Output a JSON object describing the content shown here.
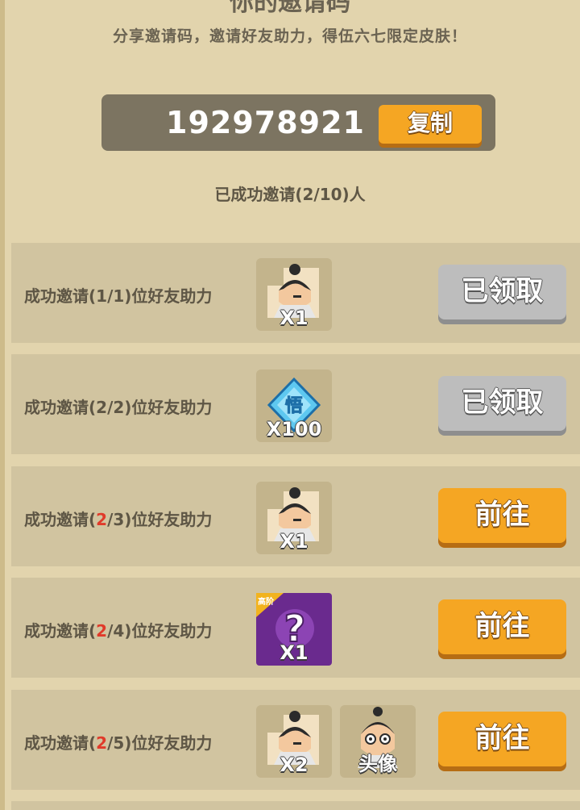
{
  "header": {
    "title": "你的邀请码",
    "subtitle": "分享邀请码，邀请好友助力，得伍六七限定皮肤！"
  },
  "invite": {
    "code": "192978921",
    "copy_label": "复制",
    "progress_text": "已成功邀请(2/10)人"
  },
  "colors": {
    "background": "#e2d4ad",
    "row": "#d1c4a0",
    "accent": "#f5a623",
    "highlight": "#e03a2a",
    "claimed": "#bdbdbd"
  },
  "rewards": [
    {
      "label_prefix": "成功邀请(",
      "done": "1",
      "sep_total": "/1)位好友助力",
      "done_highlighted": false,
      "items": [
        {
          "icon": "character-fragment-icon",
          "qty": "X1"
        }
      ],
      "button": "已领取",
      "state": "claimed"
    },
    {
      "label_prefix": "成功邀请(",
      "done": "2",
      "sep_total": "/2)位好友助力",
      "done_highlighted": false,
      "items": [
        {
          "icon": "wu-diamond-currency-icon",
          "qty": "X100"
        }
      ],
      "button": "已领取",
      "state": "claimed"
    },
    {
      "label_prefix": "成功邀请(",
      "done": "2",
      "sep_total": "/3)位好友助力",
      "done_highlighted": true,
      "items": [
        {
          "icon": "character-fragment-icon",
          "qty": "X1"
        }
      ],
      "button": "前往",
      "state": "go"
    },
    {
      "label_prefix": "成功邀请(",
      "done": "2",
      "sep_total": "/4)位好友助力",
      "done_highlighted": true,
      "items": [
        {
          "icon": "mystery-box-icon",
          "qty": "X1",
          "tag": "高阶"
        }
      ],
      "button": "前往",
      "state": "go"
    },
    {
      "label_prefix": "成功邀请(",
      "done": "2",
      "sep_total": "/5)位好友助力",
      "done_highlighted": true,
      "items": [
        {
          "icon": "character-fragment-icon",
          "qty": "X2"
        },
        {
          "icon": "avatar-portrait-icon",
          "qty": "头像"
        }
      ],
      "button": "前往",
      "state": "go"
    }
  ]
}
